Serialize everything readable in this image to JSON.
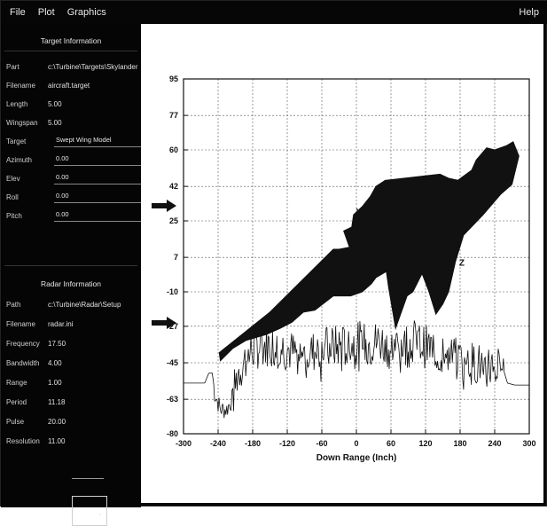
{
  "menu": {
    "file": "File",
    "plot": "Plot",
    "graphics": "Graphics",
    "help": "Help"
  },
  "sidebar": {
    "target_section_title": "Target Information",
    "target_rows": [
      {
        "label": "Part",
        "value": "c:\\Turbine\\Targets\\Skylander",
        "kind": "text"
      },
      {
        "label": "Filename",
        "value": "aircraft.target",
        "kind": "text"
      },
      {
        "label": "Length",
        "value": "5.00",
        "kind": "text"
      },
      {
        "label": "Wingspan",
        "value": "5.00",
        "kind": "text"
      },
      {
        "label": "Target",
        "value": "Swept Wing Model",
        "kind": "field"
      },
      {
        "label": "Azimuth",
        "value": "0.00",
        "kind": "field"
      },
      {
        "label": "Elev",
        "value": "0.00",
        "kind": "field"
      },
      {
        "label": "Roll",
        "value": "0.00",
        "kind": "field"
      },
      {
        "label": "Pitch",
        "value": "0.00",
        "kind": "field"
      }
    ],
    "radar_section_title": "Radar Information",
    "radar_rows": [
      {
        "label": "Path",
        "value": "c:\\Turbine\\Radar\\Setup"
      },
      {
        "label": "Filename",
        "value": "radar.ini"
      },
      {
        "label": "Frequency",
        "value": "17.50"
      },
      {
        "label": "Bandwidth",
        "value": "4.00"
      },
      {
        "label": "Range",
        "value": "1.00"
      },
      {
        "label": "Period",
        "value": "11.18"
      },
      {
        "label": "Pulse",
        "value": "20.00"
      },
      {
        "label": "Resolution",
        "value": "11.00"
      }
    ]
  },
  "chart_data": {
    "type": "line",
    "xlabel": "Down Range (Inch)",
    "ylabel": "",
    "xlim": [
      -300,
      300
    ],
    "ylim": [
      -80,
      95
    ],
    "x_ticks": [
      -300,
      -240,
      -180,
      -120,
      -60,
      0,
      60,
      120,
      180,
      240,
      300
    ],
    "y_ticks": [
      -80,
      -63,
      -45,
      -27,
      -10,
      7,
      25,
      42,
      60,
      77,
      95
    ],
    "grid": true,
    "annotations": [
      {
        "text": "X",
        "x": 4,
        "y": 28
      },
      {
        "text": "Z",
        "x": 183,
        "y": 3
      }
    ],
    "series": [
      {
        "type": "filled-shape",
        "color": "#111111",
        "points": [
          [
            -238,
            -40
          ],
          [
            -150,
            -20
          ],
          [
            -40,
            11
          ],
          [
            -30,
            11
          ],
          [
            -12,
            12
          ],
          [
            -22,
            20
          ],
          [
            -8,
            22
          ],
          [
            -5,
            28
          ],
          [
            10,
            32
          ],
          [
            24,
            37
          ],
          [
            34,
            42
          ],
          [
            50,
            45
          ],
          [
            145,
            48
          ],
          [
            160,
            46
          ],
          [
            176,
            45
          ],
          [
            200,
            50
          ],
          [
            208,
            55
          ],
          [
            226,
            61
          ],
          [
            240,
            60
          ],
          [
            260,
            62
          ],
          [
            272,
            64
          ],
          [
            282,
            57
          ],
          [
            270,
            43
          ],
          [
            250,
            38
          ],
          [
            220,
            28
          ],
          [
            186,
            18
          ],
          [
            172,
            5
          ],
          [
            160,
            -10
          ],
          [
            150,
            -16
          ],
          [
            138,
            -21
          ],
          [
            126,
            -10
          ],
          [
            114,
            -1
          ],
          [
            98,
            -10
          ],
          [
            88,
            -12
          ],
          [
            68,
            -28
          ],
          [
            56,
            -8
          ],
          [
            52,
            0
          ],
          [
            34,
            -3
          ],
          [
            26,
            -6
          ],
          [
            10,
            -10
          ],
          [
            -10,
            -12
          ],
          [
            -40,
            -12
          ],
          [
            -72,
            -19
          ],
          [
            -92,
            -20
          ],
          [
            -112,
            -25
          ],
          [
            -132,
            -28
          ],
          [
            -156,
            -31
          ],
          [
            -192,
            -34
          ],
          [
            -215,
            -38
          ],
          [
            -236,
            -44
          ]
        ]
      },
      {
        "type": "line",
        "color": "#111111",
        "noise_seed": 7,
        "points": [
          [
            -300,
            -55
          ],
          [
            -263,
            -55
          ],
          [
            -256,
            -50
          ],
          [
            -250,
            -50
          ],
          [
            -246,
            -60
          ],
          [
            -236,
            -68
          ],
          [
            -225,
            -68
          ],
          [
            -214,
            -62
          ],
          [
            -206,
            -50
          ],
          [
            -180,
            -38
          ],
          [
            -150,
            -36
          ],
          [
            -120,
            -38
          ],
          [
            -100,
            -42
          ],
          [
            -80,
            -40
          ],
          [
            -60,
            -38
          ],
          [
            -40,
            -37
          ],
          [
            -20,
            -37
          ],
          [
            0,
            -35
          ],
          [
            20,
            -36
          ],
          [
            40,
            -34
          ],
          [
            60,
            -38
          ],
          [
            80,
            -36
          ],
          [
            100,
            -34
          ],
          [
            120,
            -37
          ],
          [
            140,
            -39
          ],
          [
            160,
            -42
          ],
          [
            180,
            -44
          ],
          [
            200,
            -45
          ],
          [
            220,
            -46
          ],
          [
            240,
            -47
          ],
          [
            255,
            -48
          ],
          [
            262,
            -55
          ],
          [
            275,
            -56
          ],
          [
            300,
            -56
          ]
        ]
      }
    ]
  }
}
